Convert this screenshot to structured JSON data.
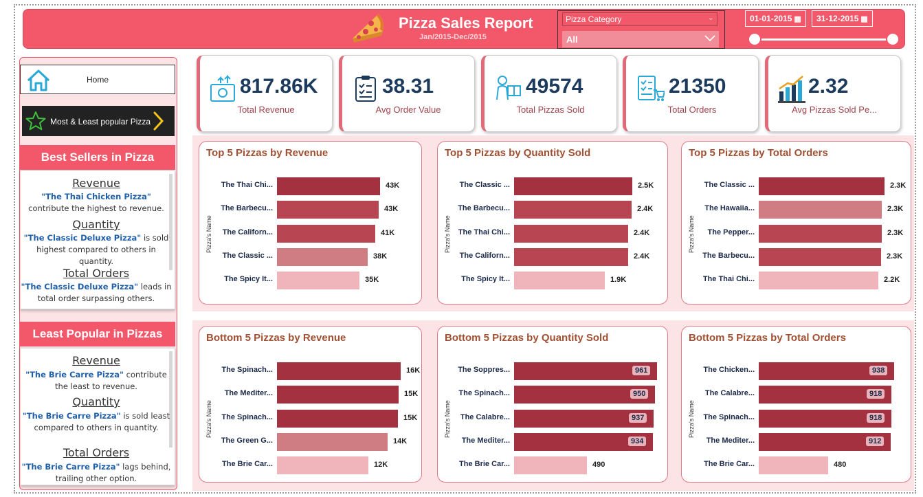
{
  "header": {
    "title": "Pizza Sales Report",
    "subtitle": "Jan/2015-Dec/2015",
    "category_slicer": {
      "label": "Pizza Category",
      "value": "All"
    },
    "date_start": "01-01-2015",
    "date_end": "31-12-2015"
  },
  "sidebar": {
    "home_label": "Home",
    "popular_label": "Most & Least popular Pizza",
    "best": {
      "heading": "Best Sellers in Pizza",
      "revenue_title": "Revenue",
      "revenue_name": "\"The Thai Chicken Pizza\"",
      "revenue_text": "contribute the highest to revenue.",
      "quantity_title": "Quantity",
      "quantity_name": "\"The Classic Deluxe Pizza\"",
      "quantity_text1": "is sold",
      "quantity_text2": "highest  compared to others in quantity.",
      "orders_title": "Total Orders",
      "orders_name": "\"The Classic Deluxe Pizza\"",
      "orders_text1": "leads in",
      "orders_text2": "total order surpassing others."
    },
    "least": {
      "heading": "Least Popular in Pizzas",
      "revenue_title": "Revenue",
      "revenue_name": "\"The Brie Carre Pizza\"",
      "revenue_text1": "contribute",
      "revenue_text2": "the least to revenue.",
      "quantity_title": "Quantity",
      "quantity_name": "\"The Brie Carre Pizza\"",
      "quantity_text1": "is sold least",
      "quantity_text2": "compared to others in quantity.",
      "orders_title": "Total Orders",
      "orders_name": "\"The Brie Carre Pizza\"",
      "orders_text1": "lags behind,",
      "orders_text2": "trailing other option."
    }
  },
  "kpis": [
    {
      "value": "817.86K",
      "label": "Total Revenue",
      "icon": "money-icon"
    },
    {
      "value": "38.31",
      "label": "Avg Order Value",
      "icon": "clipboard-icon"
    },
    {
      "value": "49574",
      "label": "Total Pizzas Sold",
      "icon": "delivery-icon"
    },
    {
      "value": "21350",
      "label": "Total Orders",
      "icon": "order-list-icon"
    },
    {
      "value": "2.32",
      "label": "Avg Pizzas Sold Pe...",
      "icon": "bar-growth-icon"
    }
  ],
  "colors": {
    "accent": "#f2586a",
    "bar_dark": "#a33140",
    "bar_mid": "#b84652",
    "bar_soft": "#cf7c83",
    "bar_light": "#efb5ba"
  },
  "chart_data": [
    {
      "type": "bar",
      "orientation": "horizontal",
      "title": "Top 5 Pizzas by Revenue",
      "ylabel": "Pizza's Name",
      "categories": [
        "The Thai Chi...",
        "The Barbecu...",
        "The Californ...",
        "The Classic ...",
        "The Spicy It..."
      ],
      "values": [
        43434,
        42768,
        41410,
        38180,
        34831
      ],
      "labels": [
        "43K",
        "43K",
        "41K",
        "38K",
        "35K"
      ],
      "shades": [
        "bar_dark",
        "bar_mid",
        "bar_mid",
        "bar_soft",
        "bar_light"
      ],
      "xmax": 48000,
      "label_style": "outside"
    },
    {
      "type": "bar",
      "orientation": "horizontal",
      "title": "Top 5 Pizzas by Quantity Sold",
      "ylabel": "Pizza's Name",
      "categories": [
        "The Classic ...",
        "The Barbecu...",
        "The Thai Chi...",
        "The Californ...",
        "The Spicy It..."
      ],
      "values": [
        2453,
        2432,
        2371,
        2370,
        1887
      ],
      "labels": [
        "2.5K",
        "2.4K",
        "2.4K",
        "2.4K",
        "1.9K"
      ],
      "shades": [
        "bar_dark",
        "bar_mid",
        "bar_mid",
        "bar_mid",
        "bar_light"
      ],
      "xmax": 2650,
      "label_style": "outside"
    },
    {
      "type": "bar",
      "orientation": "horizontal",
      "title": "Top 5 Pizzas by Total Orders",
      "ylabel": "Pizza's Name",
      "categories": [
        "The Classic ...",
        "The Hawaiia...",
        "The Pepper...",
        "The Barbecu...",
        "The Thai Chi..."
      ],
      "values": [
        2329,
        2280,
        2278,
        2273,
        2225
      ],
      "labels": [
        "2.3K",
        "2.3K",
        "2.3K",
        "2.3K",
        "2.2K"
      ],
      "shades": [
        "bar_dark",
        "bar_soft",
        "bar_mid",
        "bar_mid",
        "bar_light"
      ],
      "xmax": 2500,
      "label_style": "outside"
    },
    {
      "type": "bar",
      "orientation": "horizontal",
      "title": "Bottom 5 Pizzas by Revenue",
      "ylabel": "Pizza's Name",
      "categories": [
        "The Spinach...",
        "The Mediter...",
        "The Spinach...",
        "The Green G...",
        "The Brie Car..."
      ],
      "values": [
        15596,
        15360,
        15277,
        13956,
        11588
      ],
      "labels": [
        "16K",
        "15K",
        "15K",
        "14K",
        "12K"
      ],
      "shades": [
        "bar_dark",
        "bar_dark",
        "bar_dark",
        "bar_soft",
        "bar_light"
      ],
      "xmax": 16500,
      "label_style": "outside"
    },
    {
      "type": "bar",
      "orientation": "horizontal",
      "title": "Bottom 5 Pizzas by Quantity Sold",
      "ylabel": "Pizza's Name",
      "categories": [
        "The Soppres...",
        "The Spinach...",
        "The Calabre...",
        "The Mediter...",
        "The Brie Car..."
      ],
      "values": [
        961,
        950,
        937,
        934,
        490
      ],
      "labels": [
        "961",
        "950",
        "937",
        "934",
        "490"
      ],
      "shades": [
        "bar_dark",
        "bar_dark",
        "bar_dark",
        "bar_dark",
        "bar_light"
      ],
      "xmax": 990,
      "label_style": "inside"
    },
    {
      "type": "bar",
      "orientation": "horizontal",
      "title": "Bottom 5 Pizzas by Total Orders",
      "ylabel": "Pizza's Name",
      "categories": [
        "The Chicken...",
        "The Calabre...",
        "The Spinach...",
        "The Mediter...",
        "The Brie Car..."
      ],
      "values": [
        938,
        918,
        918,
        912,
        480
      ],
      "labels": [
        "938",
        "918",
        "918",
        "912",
        "480"
      ],
      "shades": [
        "bar_dark",
        "bar_dark",
        "bar_dark",
        "bar_dark",
        "bar_light"
      ],
      "xmax": 966,
      "label_style": "inside"
    }
  ]
}
